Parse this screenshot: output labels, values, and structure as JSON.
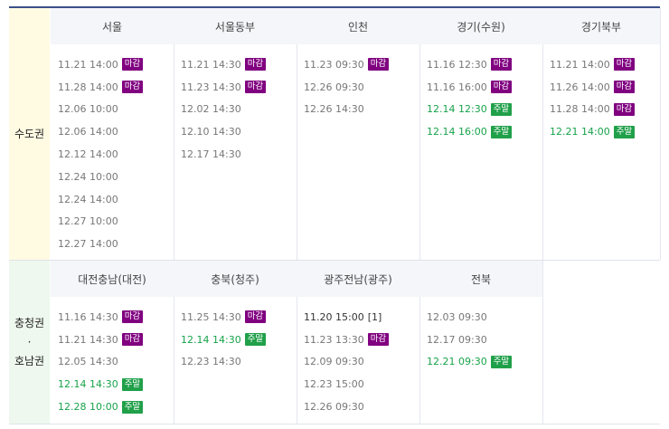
{
  "colors": {
    "closed_badge": "#800080",
    "weekend_badge": "#21a04a",
    "capital_bg": "#fffbe3",
    "south_bg": "#eef8ee"
  },
  "regions": [
    {
      "label_lines": [
        "수도권"
      ],
      "columns": [
        {
          "name": "서울",
          "sessions": [
            {
              "text": "11.21 14:00",
              "badge": "마감",
              "kind": "closed"
            },
            {
              "text": "11.28 14:00",
              "badge": "마감",
              "kind": "closed"
            },
            {
              "text": "12.06 10:00"
            },
            {
              "text": "12.06 14:00"
            },
            {
              "text": "12.12 14:00"
            },
            {
              "text": "12.24 10:00"
            },
            {
              "text": "12.24 14:00"
            },
            {
              "text": "12.27 10:00"
            },
            {
              "text": "12.27 14:00"
            }
          ]
        },
        {
          "name": "서울동부",
          "sessions": [
            {
              "text": "11.21 14:30",
              "badge": "마감",
              "kind": "closed"
            },
            {
              "text": "11.23 14:30",
              "badge": "마감",
              "kind": "closed"
            },
            {
              "text": "12.02 14:30"
            },
            {
              "text": "12.10 14:30"
            },
            {
              "text": "12.17 14:30"
            }
          ]
        },
        {
          "name": "인천",
          "sessions": [
            {
              "text": "11.23 09:30",
              "badge": "마감",
              "kind": "closed"
            },
            {
              "text": "12.26 09:30"
            },
            {
              "text": "12.26 14:30"
            }
          ]
        },
        {
          "name": "경기(수원)",
          "sessions": [
            {
              "text": "11.16 12:30",
              "badge": "마감",
              "kind": "closed"
            },
            {
              "text": "11.16 16:00",
              "badge": "마감",
              "kind": "closed"
            },
            {
              "text": "12.14 12:30",
              "badge": "주말",
              "kind": "weekend"
            },
            {
              "text": "12.14 16:00",
              "badge": "주말",
              "kind": "weekend"
            }
          ]
        },
        {
          "name": "경기북부",
          "sessions": [
            {
              "text": "11.21 14:00",
              "badge": "마감",
              "kind": "closed"
            },
            {
              "text": "11.26 14:00",
              "badge": "마감",
              "kind": "closed"
            },
            {
              "text": "11.28 14:00",
              "badge": "마감",
              "kind": "closed"
            },
            {
              "text": "12.21 14:00",
              "badge": "주말",
              "kind": "weekend"
            }
          ]
        }
      ]
    },
    {
      "label_lines": [
        "충청권",
        "·",
        "호남권"
      ],
      "columns": [
        {
          "name": "대전충남(대전)",
          "sessions": [
            {
              "text": "11.16 14:30",
              "badge": "마감",
              "kind": "closed"
            },
            {
              "text": "11.21 14:30",
              "badge": "마감",
              "kind": "closed"
            },
            {
              "text": "12.05 14:30"
            },
            {
              "text": "12.14 14:30",
              "badge": "주말",
              "kind": "weekend"
            },
            {
              "text": "12.28 10:00",
              "badge": "주말",
              "kind": "weekend"
            }
          ]
        },
        {
          "name": "충북(청주)",
          "sessions": [
            {
              "text": "11.25 14:30",
              "badge": "마감",
              "kind": "closed"
            },
            {
              "text": "12.14 14:30",
              "badge": "주말",
              "kind": "weekend"
            },
            {
              "text": "12.23 14:30"
            }
          ]
        },
        {
          "name": "광주전남(광주)",
          "sessions": [
            {
              "text": "11.20 15:00",
              "note": "[1]",
              "kind": "strong"
            },
            {
              "text": "11.23 13:30",
              "badge": "마감",
              "kind": "closed"
            },
            {
              "text": "12.09 09:30"
            },
            {
              "text": "12.23 15:00"
            },
            {
              "text": "12.26 09:30"
            }
          ]
        },
        {
          "name": "전북",
          "sessions": [
            {
              "text": "12.03 09:30"
            },
            {
              "text": "12.17 09:30"
            },
            {
              "text": "12.21 09:30",
              "badge": "주말",
              "kind": "weekend"
            }
          ]
        }
      ]
    }
  ]
}
